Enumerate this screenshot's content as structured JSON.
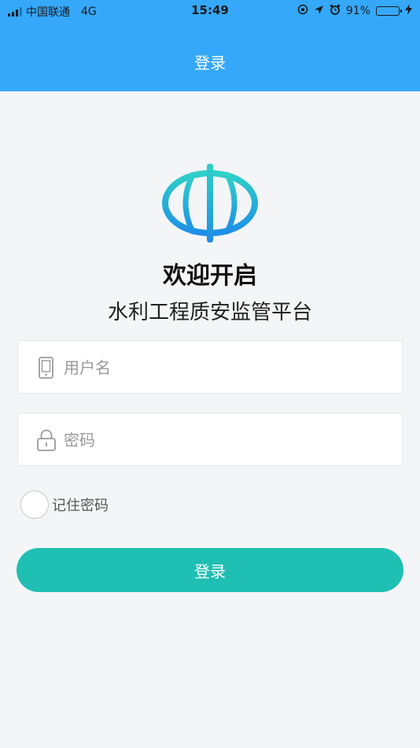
{
  "status_bar": {
    "carrier": "中国联通",
    "network": "4G",
    "time": "15:49",
    "battery_percent": "91%",
    "battery_level": 0.91,
    "icons": [
      "signal-icon",
      "orientation-lock-icon",
      "location-arrow-icon",
      "alarm-icon",
      "battery-icon",
      "charging-icon"
    ]
  },
  "header": {
    "title": "登录",
    "background_color": "#35a8fa"
  },
  "hero": {
    "logo_icon": "water-conservancy-logo-icon",
    "welcome": "欢迎开启",
    "subtitle": "水利工程质安监管平台"
  },
  "form": {
    "username": {
      "placeholder": "用户名",
      "value": "",
      "icon": "phone-icon"
    },
    "password": {
      "placeholder": "密码",
      "value": "",
      "icon": "lock-icon"
    },
    "remember_label": "记住密码",
    "remember_checked": false,
    "login_label": "登录",
    "login_color": "#1fbfb3"
  }
}
